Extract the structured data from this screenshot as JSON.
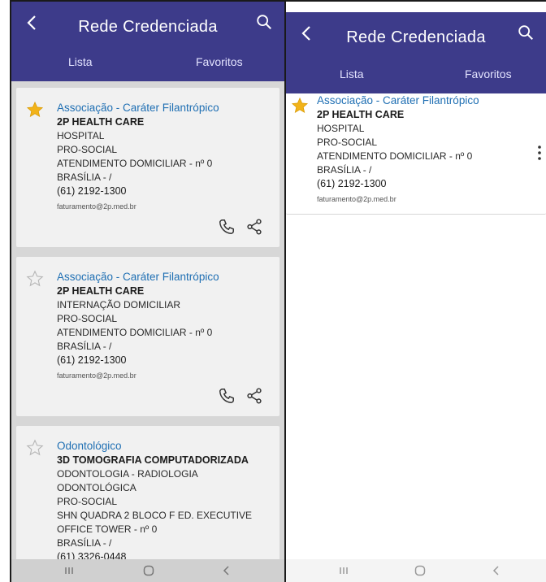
{
  "left_screen": {
    "title": "Rede Credenciada",
    "tabs": [
      "Lista",
      "Favoritos"
    ],
    "cards": [
      {
        "favorite": true,
        "category": "Associação - Caráter Filantrópico",
        "name": "2P HEALTH CARE",
        "lines": [
          "HOSPITAL",
          "PRO-SOCIAL",
          "ATENDIMENTO DOMICILIAR - nº 0",
          "BRASÍLIA - /"
        ],
        "phone": "(61) 2192-1300",
        "email": "faturamento@2p.med.br"
      },
      {
        "favorite": false,
        "category": "Associação - Caráter Filantrópico",
        "name": "2P HEALTH CARE",
        "lines": [
          "INTERNAÇÃO DOMICILIAR",
          "PRO-SOCIAL",
          "ATENDIMENTO DOMICILIAR - nº 0",
          "BRASÍLIA - /"
        ],
        "phone": "(61) 2192-1300",
        "email": "faturamento@2p.med.br"
      },
      {
        "favorite": false,
        "category": "Odontológico",
        "name": "3D TOMOGRAFIA COMPUTADORIZADA",
        "lines": [
          "ODONTOLOGIA - RADIOLOGIA",
          "ODONTOLÓGICA",
          "PRO-SOCIAL",
          "SHN QUADRA 2 BLOCO F ED. EXECUTIVE",
          "OFFICE TOWER - nº 0",
          "BRASÍLIA - /"
        ],
        "phone": "(61) 3326-0448",
        "email": ""
      }
    ]
  },
  "right_screen": {
    "title": "Rede Credenciada",
    "tabs": [
      "Lista",
      "Favoritos"
    ],
    "cards": [
      {
        "favorite": true,
        "category": "Associação - Caráter Filantrópico",
        "name": "2P HEALTH CARE",
        "lines": [
          "HOSPITAL",
          "PRO-SOCIAL",
          "ATENDIMENTO DOMICILIAR - nº 0",
          "BRASÍLIA - /"
        ],
        "phone": "(61) 2192-1300",
        "email": "faturamento@2p.med.br"
      }
    ]
  },
  "colors": {
    "appbar": "#3d3b8a",
    "category_text": "#1f6fb3",
    "star_filled": "#f2b31a",
    "star_empty": "#b5b5b5"
  },
  "icons": [
    "back-icon",
    "search-icon",
    "star-icon",
    "phone-icon",
    "share-icon",
    "more-vert-icon",
    "nav-recents-icon",
    "nav-home-icon",
    "nav-back-icon"
  ]
}
